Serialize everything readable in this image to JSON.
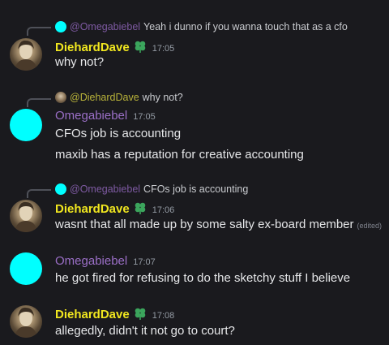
{
  "colors": {
    "background": "#1a1a1e",
    "dave_name": "#f1e71f",
    "omega_name": "#9b6fc7",
    "cyan_avatar": "#00ffff",
    "badge_green": "#3ba55c"
  },
  "messages": [
    {
      "reply": {
        "author": "@Omegabiebel",
        "text": "Yeah i dunno if you wanna touch that as a cfo",
        "avatar": "cyan"
      },
      "author": "DiehardDave",
      "time": "17:05",
      "lines": [
        "why not?"
      ]
    },
    {
      "reply": {
        "author": "@DiehardDave",
        "text": "why not?",
        "avatar": "photo"
      },
      "author": "Omegabiebel",
      "time": "17:05",
      "lines": [
        "CFOs job is accounting",
        "maxib has a reputation for creative accounting"
      ]
    },
    {
      "reply": {
        "author": "@Omegabiebel",
        "text": "CFOs job is accounting",
        "avatar": "cyan"
      },
      "author": "DiehardDave",
      "time": "17:06",
      "lines": [
        "wasnt that all made up by some salty ex-board member"
      ],
      "edited": "(edited)"
    },
    {
      "author": "Omegabiebel",
      "time": "17:07",
      "lines": [
        "he got fired for refusing to do the sketchy stuff I believe"
      ]
    },
    {
      "author": "DiehardDave",
      "time": "17:08",
      "lines": [
        "allegedly, didn't it not go to court?"
      ]
    }
  ]
}
